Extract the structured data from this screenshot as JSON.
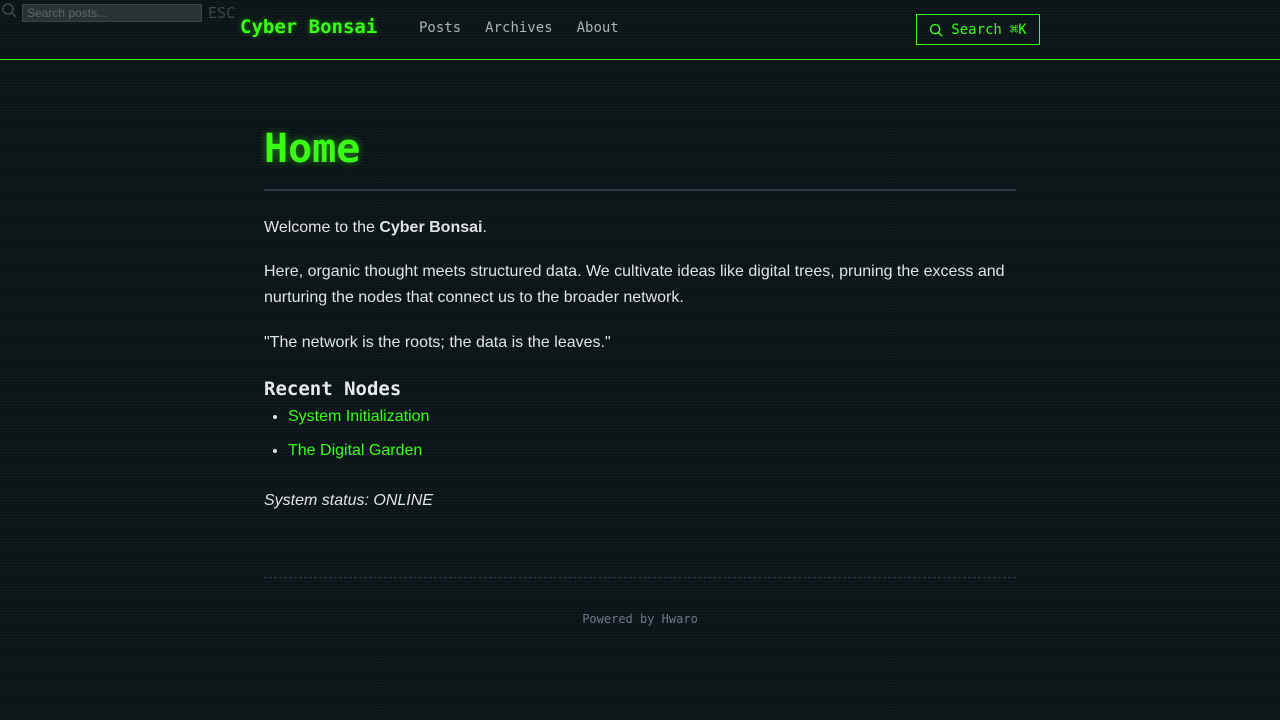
{
  "search_overlay": {
    "placeholder": "Search posts...",
    "esc_label": "ESC"
  },
  "header": {
    "brand": "Cyber Bonsai",
    "nav": [
      {
        "label": "Posts"
      },
      {
        "label": "Archives"
      },
      {
        "label": "About"
      }
    ],
    "search_button": {
      "label": "Search",
      "shortcut": "⌘K"
    }
  },
  "page": {
    "title": "Home",
    "intro_prefix": "Welcome to the ",
    "intro_bold": "Cyber Bonsai",
    "intro_suffix": ".",
    "paragraph": "Here, organic thought meets structured data. We cultivate ideas like digital trees, pruning the excess and nurturing the nodes that connect us to the broader network.",
    "quote": "\"The network is the roots; the data is the leaves.\"",
    "recent_heading": "Recent Nodes",
    "recent_nodes": [
      {
        "label": "System Initialization"
      },
      {
        "label": "The Digital Garden"
      }
    ],
    "status": "System status: ONLINE"
  },
  "footer": {
    "text": "Powered by Hwaro"
  },
  "colors": {
    "background": "#0b1418",
    "accent": "#39ff14",
    "text": "#dfe3e6",
    "muted": "#6c7a82"
  },
  "icons": {
    "search": "search-icon"
  }
}
